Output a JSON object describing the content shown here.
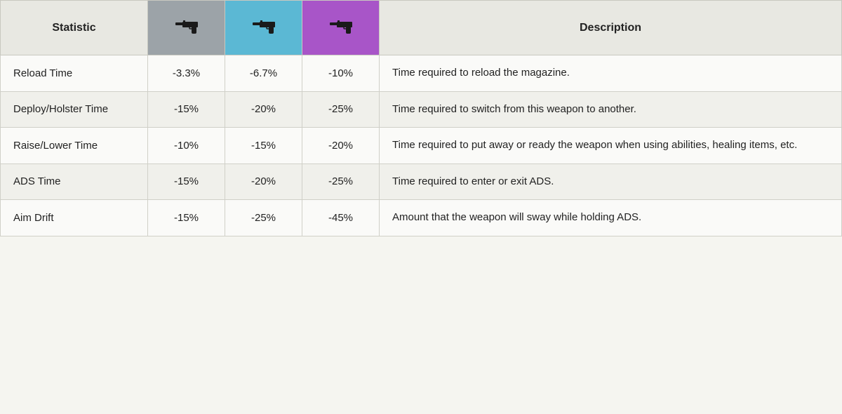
{
  "header": {
    "statistic_label": "Statistic",
    "description_label": "Description",
    "tier1_icon": "gun-icon",
    "tier2_icon": "gun-icon",
    "tier3_icon": "gun-icon"
  },
  "rows": [
    {
      "stat": "Reload Time",
      "tier1": "-3.3%",
      "tier2": "-6.7%",
      "tier3": "-10%",
      "description": "Time required to reload the magazine."
    },
    {
      "stat": "Deploy/Holster Time",
      "tier1": "-15%",
      "tier2": "-20%",
      "tier3": "-25%",
      "description": "Time required to switch from this weapon to another."
    },
    {
      "stat": "Raise/Lower Time",
      "tier1": "-10%",
      "tier2": "-15%",
      "tier3": "-20%",
      "description": "Time required to put away or ready the weapon when using abilities, healing items, etc."
    },
    {
      "stat": "ADS Time",
      "tier1": "-15%",
      "tier2": "-20%",
      "tier3": "-25%",
      "description": "Time required to enter or exit ADS."
    },
    {
      "stat": "Aim Drift",
      "tier1": "-15%",
      "tier2": "-25%",
      "tier3": "-45%",
      "description": "Amount that the weapon will sway while holding ADS."
    }
  ]
}
